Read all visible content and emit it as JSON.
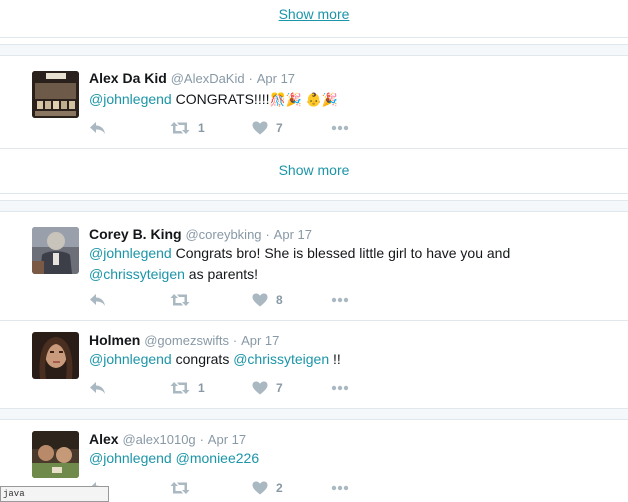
{
  "show_more_label": "Show more",
  "tweets": [
    {
      "name": "Alex Da Kid",
      "handle": "@AlexDaKid",
      "date": "Apr 17",
      "text_parts": [
        {
          "type": "mention",
          "text": "@johnlegend"
        },
        {
          "type": "text",
          "text": " CONGRATS!!!!"
        },
        {
          "type": "emoji",
          "text": "🎊🎉 👶🎉"
        }
      ],
      "retweets": "1",
      "likes": "7"
    },
    {
      "name": "Corey B. King",
      "handle": "@coreybking",
      "date": "Apr 17",
      "line1": [
        {
          "type": "mention",
          "text": "@johnlegend"
        },
        {
          "type": "text",
          "text": " Congrats bro! She is blessed little girl to have you and"
        }
      ],
      "line2": [
        {
          "type": "mention",
          "text": "@chrissyteigen"
        },
        {
          "type": "text",
          "text": " as parents!"
        }
      ],
      "retweets": "",
      "likes": "8"
    },
    {
      "name": "Holmen",
      "handle": "@gomezswifts",
      "date": "Apr 17",
      "text_parts": [
        {
          "type": "mention",
          "text": "@johnlegend"
        },
        {
          "type": "text",
          "text": " congrats "
        },
        {
          "type": "mention",
          "text": "@chrissyteigen"
        },
        {
          "type": "text",
          "text": " !!"
        }
      ],
      "retweets": "1",
      "likes": "7"
    },
    {
      "name": "Alex",
      "handle": "@alex1010g",
      "date": "Apr 17",
      "text_parts": [
        {
          "type": "mention",
          "text": "@johnlegend"
        },
        {
          "type": "text",
          "text": " "
        },
        {
          "type": "mention",
          "text": "@moniee226"
        }
      ],
      "retweets": "",
      "likes": "2"
    }
  ],
  "dot_separator": "·",
  "tooltip_text": "java",
  "colors": {
    "link": "#1b95a8",
    "muted": "#8899a6",
    "icon": "#aab8c2",
    "divider": "#e1e8ed",
    "gap_bg": "#f5f8fa"
  },
  "icons": {
    "reply": "reply-icon",
    "retweet": "retweet-icon",
    "like": "heart-icon",
    "more": "more-dots-icon"
  }
}
